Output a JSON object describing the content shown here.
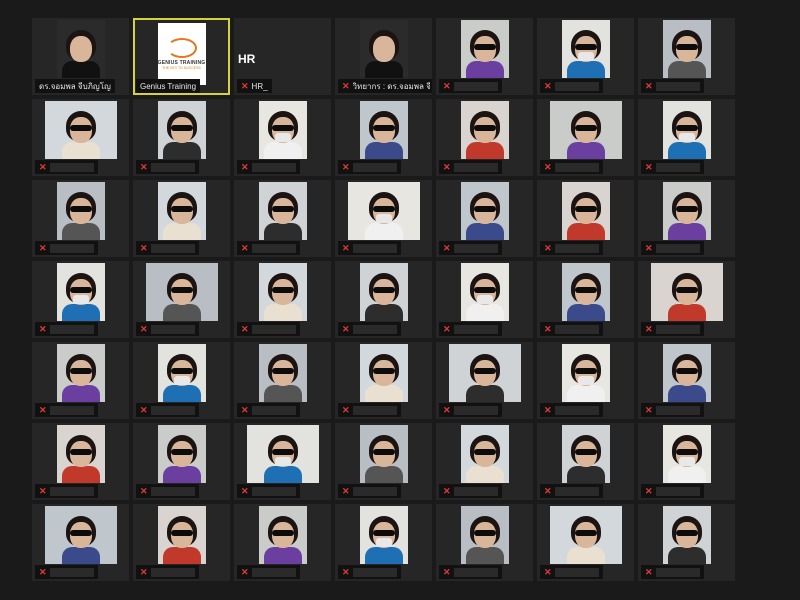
{
  "meeting": {
    "participants": [
      {
        "name": "ดร.จอมพล จีบภิญโญ",
        "muted": false,
        "video": true,
        "kind": "host"
      },
      {
        "name": "Genius Training",
        "muted": false,
        "video": true,
        "kind": "logo",
        "logo_text": "GENIUS TRAINING",
        "logo_sub": "THE KEY TO SUCCESS"
      },
      {
        "name": "HR_",
        "muted": true,
        "video": false,
        "kind": "no-video",
        "title_text": "HR"
      },
      {
        "name": "วิทยากร : ดร.จอมพล จีบภิ...",
        "muted": true,
        "video": true,
        "kind": "host"
      },
      {
        "name": "",
        "muted": true,
        "video": true
      },
      {
        "name": "",
        "muted": true,
        "video": true
      },
      {
        "name": "",
        "muted": true,
        "video": true
      },
      {
        "name": "",
        "muted": true,
        "video": true
      },
      {
        "name": "",
        "muted": true,
        "video": true
      },
      {
        "name": "",
        "muted": true,
        "video": true
      },
      {
        "name": "",
        "muted": true,
        "video": true
      },
      {
        "name": "",
        "muted": true,
        "video": true
      },
      {
        "name": "",
        "muted": true,
        "video": true
      },
      {
        "name": "",
        "muted": true,
        "video": true
      },
      {
        "name": "",
        "muted": true,
        "video": true
      },
      {
        "name": "",
        "muted": true,
        "video": true
      },
      {
        "name": "",
        "muted": true,
        "video": true
      },
      {
        "name": "",
        "muted": true,
        "video": true
      },
      {
        "name": "",
        "muted": true,
        "video": true
      },
      {
        "name": "",
        "muted": true,
        "video": true
      },
      {
        "name": "",
        "muted": true,
        "video": true
      },
      {
        "name": "",
        "muted": true,
        "video": true
      },
      {
        "name": "",
        "muted": true,
        "video": true
      },
      {
        "name": "",
        "muted": true,
        "video": true
      },
      {
        "name": "",
        "muted": true,
        "video": true
      },
      {
        "name": "",
        "muted": true,
        "video": true
      },
      {
        "name": "",
        "muted": true,
        "video": true
      },
      {
        "name": "",
        "muted": true,
        "video": true
      },
      {
        "name": "",
        "muted": true,
        "video": true
      },
      {
        "name": "",
        "muted": true,
        "video": true
      },
      {
        "name": "",
        "muted": true,
        "video": true
      },
      {
        "name": "",
        "muted": true,
        "video": true
      },
      {
        "name": "",
        "muted": true,
        "video": true
      },
      {
        "name": "",
        "muted": true,
        "video": true
      },
      {
        "name": "",
        "muted": true,
        "video": true
      },
      {
        "name": "",
        "muted": true,
        "video": true
      },
      {
        "name": "",
        "muted": true,
        "video": true
      },
      {
        "name": "",
        "muted": true,
        "video": true
      },
      {
        "name": "",
        "muted": true,
        "video": true
      },
      {
        "name": "",
        "muted": true,
        "video": true
      },
      {
        "name": "",
        "muted": true,
        "video": true
      },
      {
        "name": "",
        "muted": true,
        "video": true
      },
      {
        "name": "",
        "muted": true,
        "video": true
      },
      {
        "name": "",
        "muted": true,
        "video": true
      },
      {
        "name": "",
        "muted": true,
        "video": true
      },
      {
        "name": "",
        "muted": true,
        "video": true
      },
      {
        "name": "",
        "muted": true,
        "video": true
      },
      {
        "name": "",
        "muted": true,
        "video": true
      },
      {
        "name": "",
        "muted": true,
        "video": true
      }
    ],
    "active_speaker_index": 1,
    "muted_icon": "muted-mic-icon",
    "colors": {
      "background": "#1a1a1a",
      "tile": "#262626",
      "active_border": "#d6d23a",
      "muted": "#e53935"
    }
  }
}
